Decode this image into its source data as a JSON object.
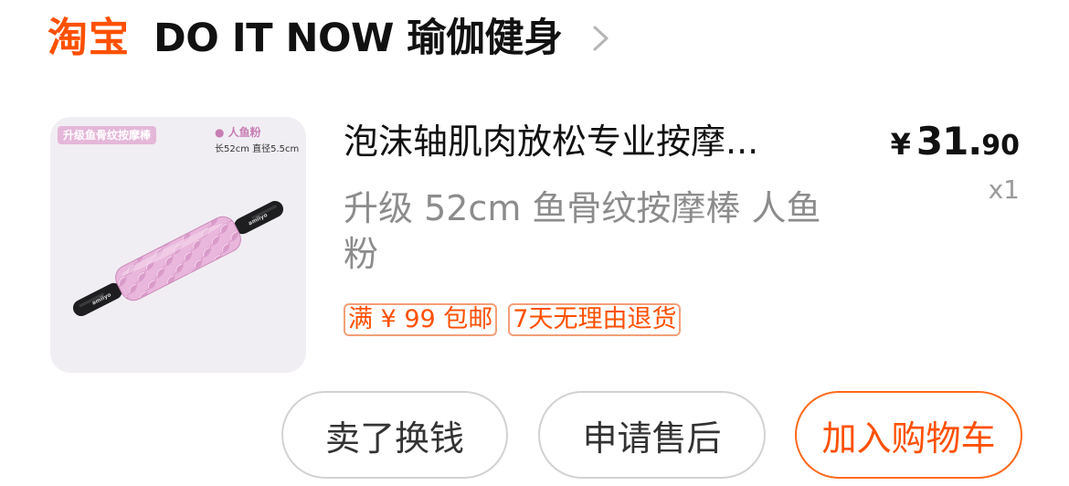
{
  "shop": {
    "platform_logo_text": "淘宝",
    "name": "DO IT NOW 瑜伽健身"
  },
  "product": {
    "image": {
      "tag": "升级鱼骨纹按摩棒",
      "color_label": "● 人鱼粉",
      "size_label": "长52cm 直径5.5cm",
      "brand_text": "amiiyo"
    },
    "title": "泡沫轴肌肉放松专业按摩...",
    "spec": "升级 52cm 鱼骨纹按摩棒 人鱼粉",
    "price": {
      "symbol": "¥",
      "integer": "31.",
      "decimal": "90"
    },
    "quantity": "x1",
    "promo_tags": [
      "满 ¥ 99 包邮",
      "7天无理由退货"
    ]
  },
  "actions": {
    "sell": "卖了换钱",
    "after_sale": "申请售后",
    "add_to_cart": "加入购物车"
  },
  "colors": {
    "brand_orange": "#ff5000",
    "promo_border": "#f39f79",
    "product_pink": "#e8b4db",
    "secondary_text": "#8c8c8c"
  },
  "icons": {
    "shop_chevron": "chevron-right-icon"
  }
}
